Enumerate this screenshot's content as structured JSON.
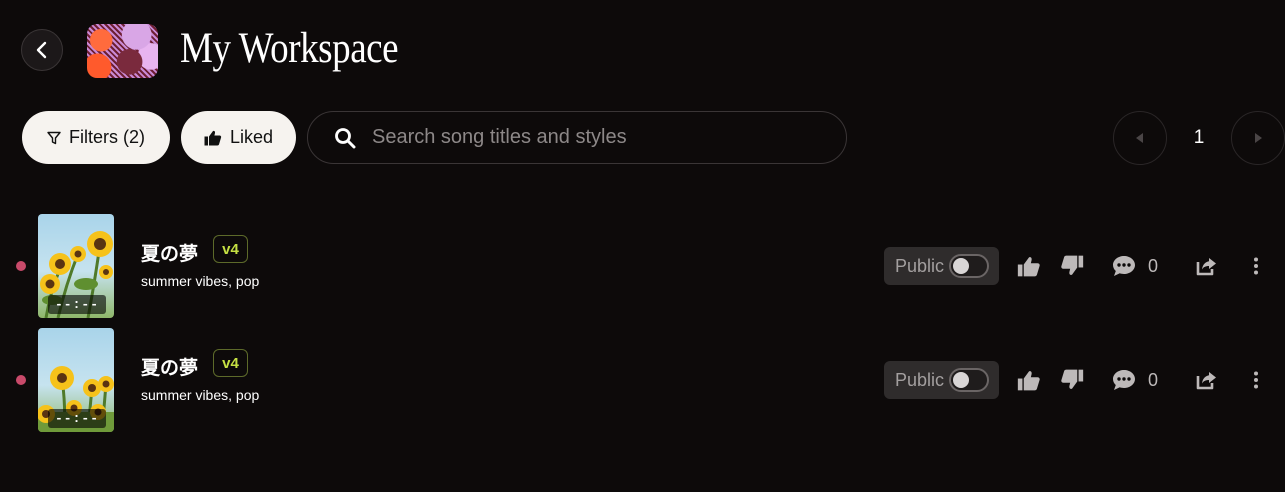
{
  "header": {
    "title": "My Workspace"
  },
  "controls": {
    "filters_label": "Filters (2)",
    "liked_label": "Liked",
    "search_placeholder": "Search song titles and styles",
    "current_page": "1"
  },
  "songs": [
    {
      "title": "夏の夢",
      "version": "v4",
      "tags": "summer vibes, pop",
      "duration": "--:--",
      "visibility_label": "Public",
      "comment_count": "0"
    },
    {
      "title": "夏の夢",
      "version": "v4",
      "tags": "summer vibes, pop",
      "duration": "--:--",
      "visibility_label": "Public",
      "comment_count": "0"
    }
  ],
  "colors": {
    "background": "#0d0a0a",
    "pill_bg": "#f6f3ef",
    "version_accent": "#c5e043",
    "unread_dot": "#c84a6a"
  },
  "icons": {
    "back": "chevron-left-icon",
    "filters": "filter-icon",
    "liked": "thumbs-up-icon",
    "search": "search-icon",
    "prev": "triangle-left-icon",
    "next": "triangle-right-icon",
    "like": "thumbs-up-icon",
    "dislike": "thumbs-down-icon",
    "comment": "comment-icon",
    "share": "share-icon",
    "more": "more-vertical-icon"
  }
}
